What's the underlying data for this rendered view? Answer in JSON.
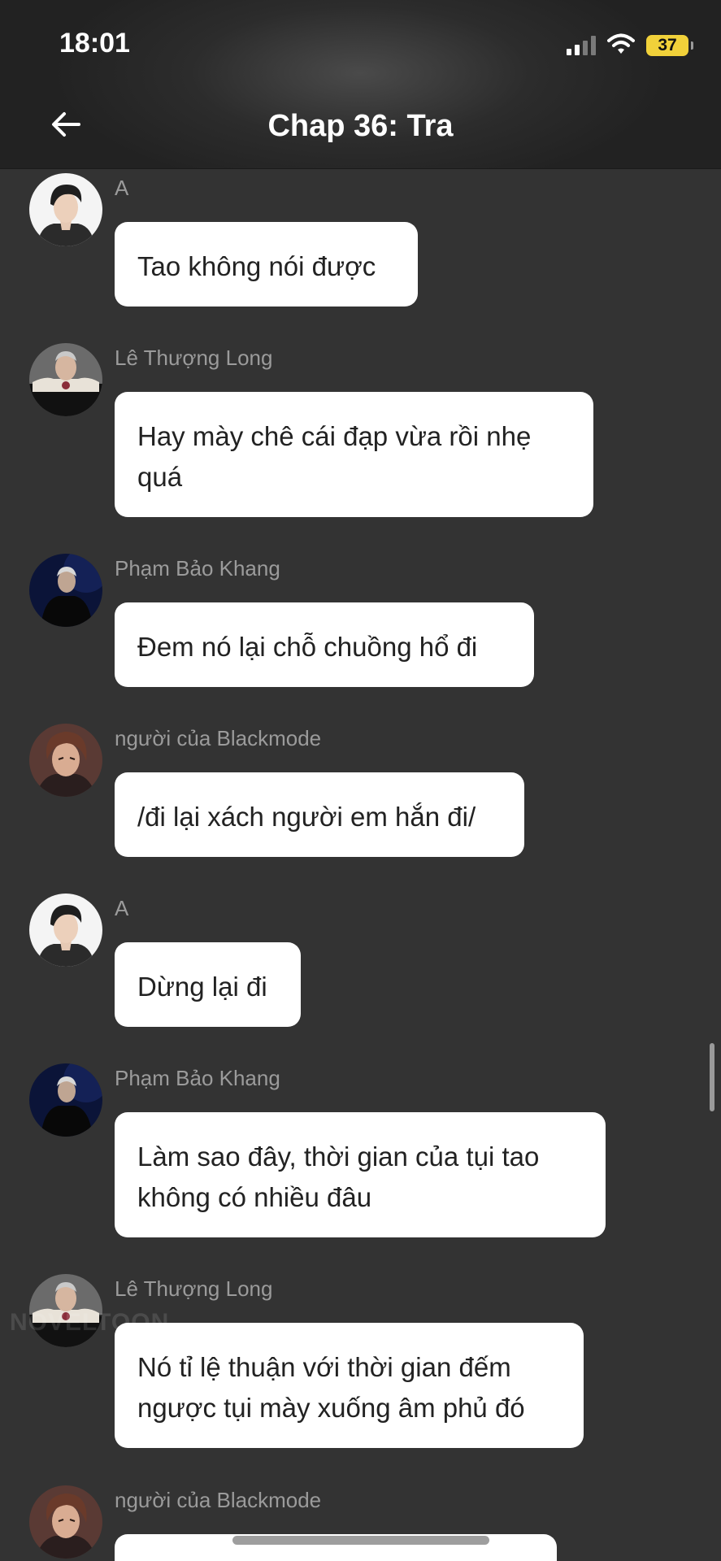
{
  "status_bar": {
    "time": "18:01",
    "battery": "37"
  },
  "nav": {
    "title": "Chap 36: Tra"
  },
  "messages": [
    {
      "sender": "A",
      "text": "Tao không nói được",
      "avatar": "avatar-a"
    },
    {
      "sender": "Lê Thượng Long",
      "text": "Hay mày chê cái đạp vừa rồi nhẹ quá",
      "avatar": "avatar-le-thuong-long"
    },
    {
      "sender": "Phạm Bảo Khang",
      "text": "Đem nó lại chỗ chuồng hổ đi",
      "avatar": "avatar-pham-bao-khang"
    },
    {
      "sender": "người của Blackmode",
      "text": "/đi lại xách người em hắn đi/",
      "avatar": "avatar-blackmode"
    },
    {
      "sender": "A",
      "text": "Dừng lại đi",
      "avatar": "avatar-a"
    },
    {
      "sender": "Phạm Bảo Khang",
      "text": "Làm sao đây, thời gian của tụi tao không có nhiều đâu",
      "avatar": "avatar-pham-bao-khang"
    },
    {
      "sender": "Lê Thượng Long",
      "text": "Nó tỉ lệ thuận với thời gian đếm ngược tụi mày xuống âm phủ đó",
      "avatar": "avatar-le-thuong-long"
    },
    {
      "sender": "người của Blackmode",
      "text": "",
      "avatar": "avatar-blackmode"
    }
  ],
  "watermark": "NOVELTOON",
  "colors": {
    "background": "#333333",
    "bubble": "#ffffff",
    "sender_text": "#9b9b9b",
    "battery": "#f1d13a"
  }
}
